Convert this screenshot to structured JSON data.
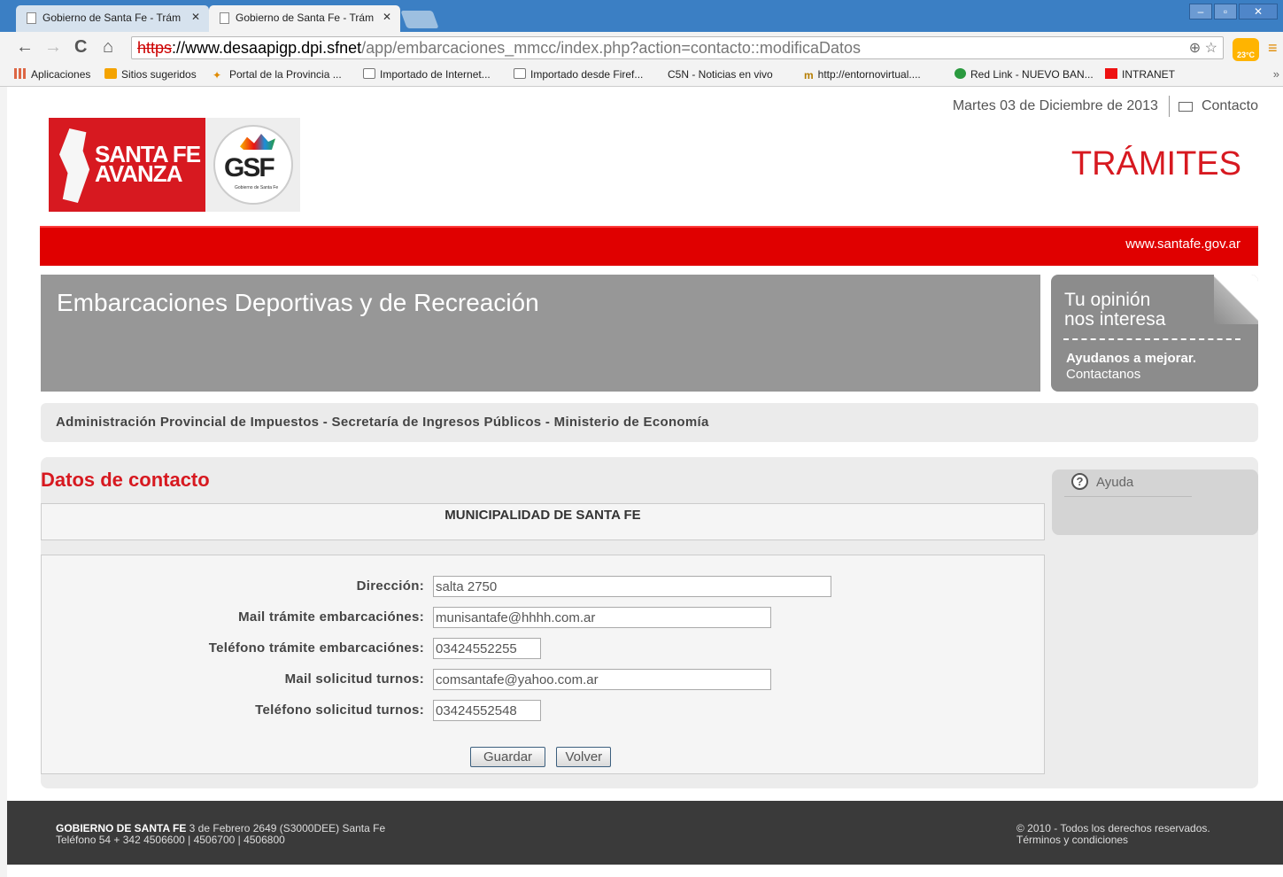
{
  "browser": {
    "tabs": [
      {
        "label": "Gobierno de Santa Fe - Trám"
      },
      {
        "label": "Gobierno de Santa Fe - Trám"
      }
    ],
    "address": {
      "proto": "https",
      "host": "://www.desaapigp.dpi.sfnet",
      "path": "/app/embarcaciones_mmcc/index.php?action=contacto::modificaDatos"
    },
    "weather": "23°C",
    "bookmarks": [
      "Aplicaciones",
      "Sitios sugeridos",
      "Portal de la Provincia ...",
      "Importado de Internet...",
      "Importado desde Firef...",
      "C5N - Noticias en vivo",
      "http://entornovirtual....",
      "Red Link - NUEVO BAN...",
      "INTRANET"
    ]
  },
  "header": {
    "date": "Martes 03 de Diciembre de 2013",
    "contact": "Contacto",
    "logo_text_1": "SANTA FE",
    "logo_text_2": "AVANZA",
    "logo_gsf": "GSF",
    "logo_gsf_sub": "Gobierno de Santa Fe",
    "section": "TRÁMITES",
    "site_url": "www.santafe.gov.ar"
  },
  "banner": {
    "title": "Embarcaciones Deportivas y de Recreación",
    "opinion_1": "Tu opinión",
    "opinion_2": "nos interesa",
    "opinion_bold": "Ayudanos a mejorar.",
    "opinion_small": "Contactanos"
  },
  "ministry": "Administración Provincial de Impuestos - Secretaría de Ingresos Públicos - Ministerio de Economía",
  "form": {
    "title": "Datos de contacto",
    "entity": "MUNICIPALIDAD DE SANTA FE",
    "fields": [
      {
        "label": "Dirección:",
        "value": "salta 2750"
      },
      {
        "label": "Mail trámite embarcaciónes:",
        "value": "munisantafe@hhhh.com.ar"
      },
      {
        "label": "Teléfono trámite embarcaciónes:",
        "value": "03424552255"
      },
      {
        "label": "Mail solicitud turnos:",
        "value": "comsantafe@yahoo.com.ar"
      },
      {
        "label": "Teléfono solicitud turnos:",
        "value": "03424552548"
      }
    ],
    "save": "Guardar",
    "back": "Volver"
  },
  "help": {
    "label": "Ayuda"
  },
  "footer": {
    "org": "GOBIERNO DE SANTA FE",
    "address": " 3 de Febrero 2649 (S3000DEE) Santa Fe",
    "phones": "Teléfono 54 + 342 4506600 | 4506700 | 4506800",
    "copyright": "© 2010 - Todos los derechos reservados.",
    "terms": "Términos y condiciones"
  }
}
